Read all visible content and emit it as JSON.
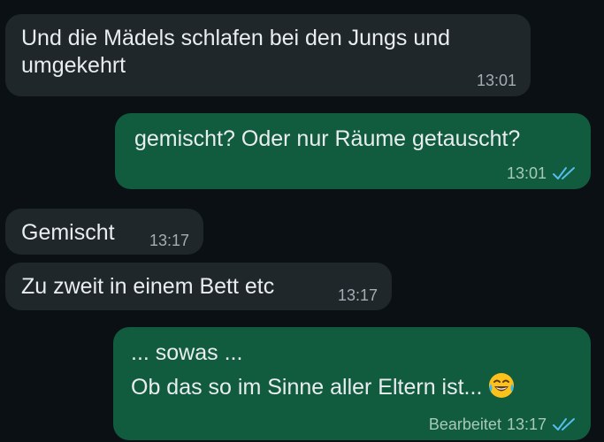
{
  "messages": [
    {
      "direction": "incoming",
      "lines": [
        "Und die Mädels schlafen bei den Jungs und",
        "umgekehrt"
      ],
      "time": "13:01"
    },
    {
      "direction": "outgoing",
      "lines": [
        "gemischt? Oder nur Räume getauscht?"
      ],
      "time": "13:01",
      "ticks": "read-double-check-icon"
    },
    {
      "direction": "incoming",
      "lines": [
        "Gemischt"
      ],
      "time": "13:17"
    },
    {
      "direction": "incoming",
      "lines": [
        "Zu zweit in einem Bett etc"
      ],
      "time": "13:17"
    },
    {
      "direction": "outgoing",
      "lines": [
        "... sowas ...",
        "Ob das so im Sinne aller Eltern ist..."
      ],
      "emoji": "tears-of-joy-emoji-icon",
      "edited_label": "Bearbeitet",
      "time": "13:17",
      "ticks": "read-double-check-icon"
    }
  ],
  "colors": {
    "background": "#0b1014",
    "incoming_bubble": "#1f272a",
    "outgoing_bubble": "#115c3f",
    "read_ticks": "#53bdeb"
  }
}
